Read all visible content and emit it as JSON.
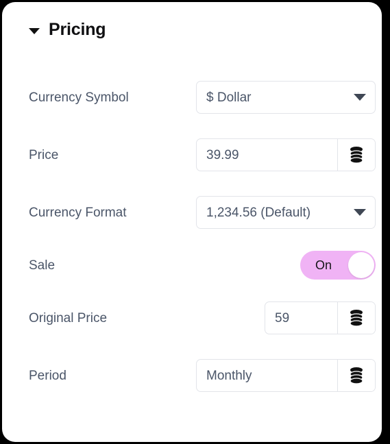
{
  "panel": {
    "header": {
      "title": "Pricing",
      "collapse_icon": "caret-down-icon"
    }
  },
  "colors": {
    "panel_background": "#ffffff",
    "page_background": "#000000",
    "label_text": "#4a5568",
    "title_text": "#101012",
    "field_border": "#e2e4e9",
    "toggle_on_track": "#f0b3f5",
    "toggle_knob": "#ffffff"
  },
  "rows": [
    {
      "label": "Currency Symbol",
      "control": "select",
      "value": "$ Dollar",
      "icon": "chevron-down-icon"
    },
    {
      "label": "Price",
      "control": "text-with-button",
      "value": "39.99",
      "icon": "database-icon"
    },
    {
      "label": "Currency Format",
      "control": "select",
      "value": "1,234.56 (Default)",
      "icon": "chevron-down-icon"
    },
    {
      "label": "Sale",
      "control": "toggle",
      "value": "On",
      "state": "on"
    },
    {
      "label": "Original Price",
      "control": "text-with-button",
      "value": "59",
      "icon": "database-icon"
    },
    {
      "label": "Period",
      "control": "text-with-button",
      "value": "Monthly",
      "icon": "database-icon"
    }
  ]
}
